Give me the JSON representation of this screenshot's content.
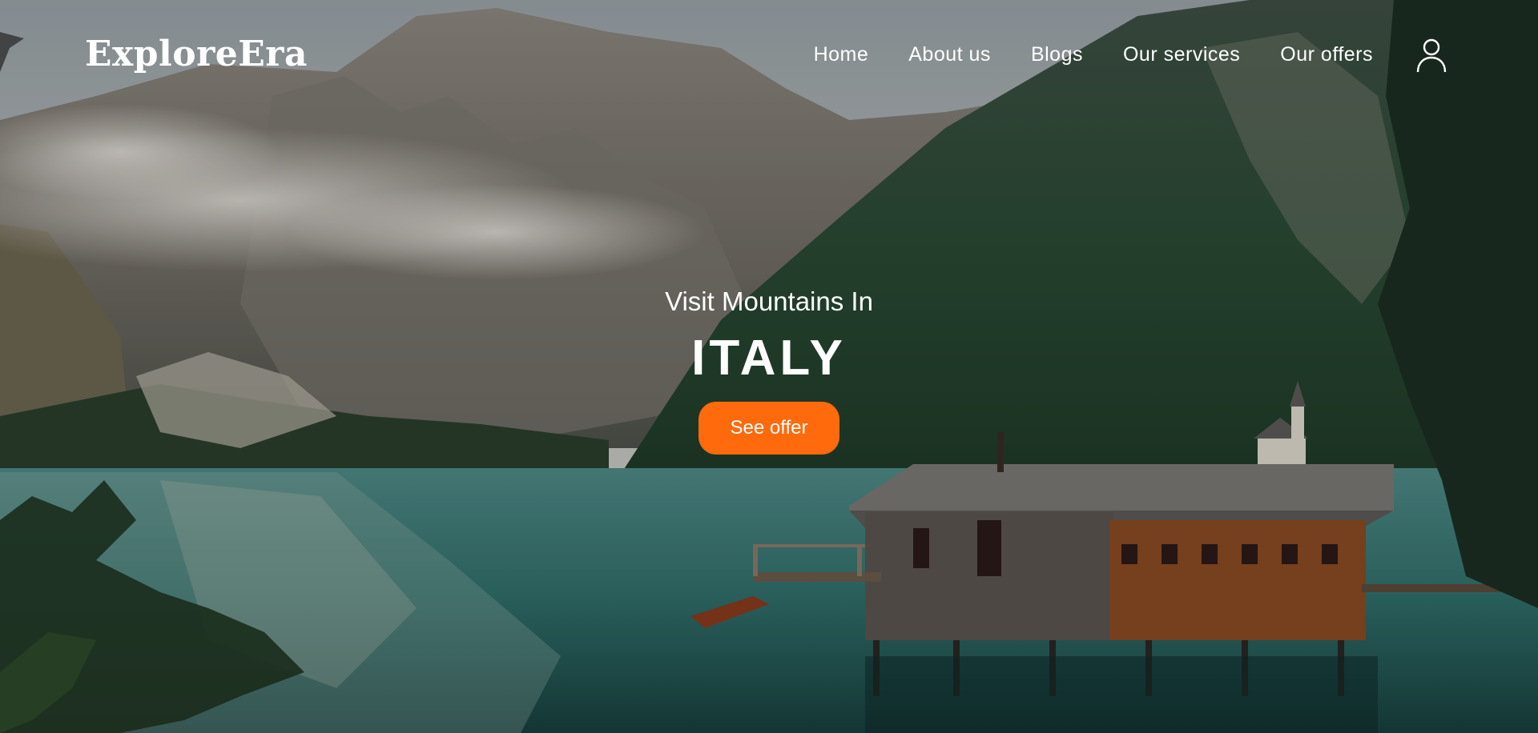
{
  "header": {
    "logo": "ExploreEra",
    "nav": [
      {
        "label": "Home"
      },
      {
        "label": "About us"
      },
      {
        "label": "Blogs"
      },
      {
        "label": "Our services"
      },
      {
        "label": "Our offers"
      }
    ],
    "user_icon": "user-icon"
  },
  "hero": {
    "eyebrow": "Visit Mountains In",
    "headline": "ITALY",
    "cta_label": "See offer",
    "background_image": "mountain-lake-boathouse"
  },
  "colors": {
    "accent": "#ff6a0d",
    "text": "#ffffff"
  }
}
